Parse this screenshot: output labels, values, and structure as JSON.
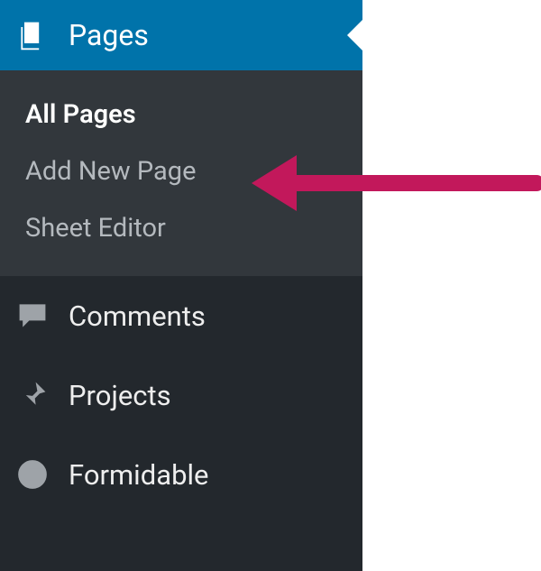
{
  "sidebar": {
    "active": {
      "label": "Pages"
    },
    "submenu": [
      {
        "label": "All Pages",
        "current": true
      },
      {
        "label": "Add New Page",
        "current": false
      },
      {
        "label": "Sheet Editor",
        "current": false
      }
    ],
    "items": [
      {
        "label": "Comments"
      },
      {
        "label": "Projects"
      },
      {
        "label": "Formidable"
      }
    ]
  },
  "annotation": {
    "arrow_color": "#c2185b"
  }
}
